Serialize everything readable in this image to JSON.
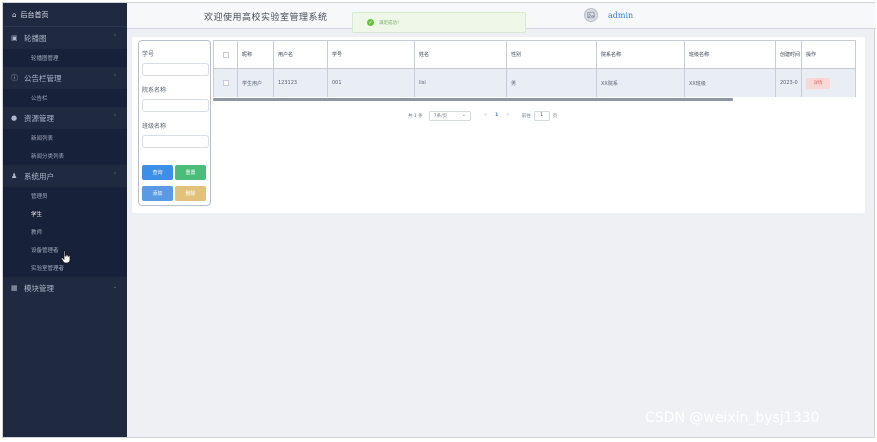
{
  "sidebar": {
    "home": "后台首页",
    "groups": [
      {
        "label": "轮播图",
        "icon": "image-icon",
        "items": [
          "轮播图管理"
        ]
      },
      {
        "label": "公告栏管理",
        "icon": "info-circle-icon",
        "items": [
          "公告栏"
        ]
      },
      {
        "label": "资源管理",
        "icon": "location-pin-icon",
        "items": [
          "新闻列表",
          "新闻分类列表"
        ]
      },
      {
        "label": "系统用户",
        "icon": "user-icon",
        "items": [
          "管理员",
          "学生",
          "教师",
          "设备管理者",
          "实验室管理者"
        ]
      },
      {
        "label": "模块管理",
        "icon": "grid-icon",
        "items": []
      }
    ],
    "active_item": "学生"
  },
  "header": {
    "title": "欢迎使用高校实验室管理系统",
    "toast": "满足成功！",
    "username": "admin"
  },
  "search": {
    "labels": [
      "学号",
      "院系名称",
      "班级名称"
    ],
    "buttons": {
      "search": "查询",
      "reset": "重置",
      "add": "添加",
      "delete": "删除"
    }
  },
  "table": {
    "columns": [
      "昵称",
      "用户名",
      "学号",
      "姓名",
      "性别",
      "院系名称",
      "班级名称",
      "创建时间",
      "操作"
    ],
    "rows": [
      {
        "nickname": "学生用户",
        "username": "123123",
        "student_id": "001",
        "name": "lisi",
        "gender": "男",
        "department": "XX院系",
        "class": "XX班级",
        "created": "2023-0",
        "action": "详情"
      }
    ]
  },
  "pagination": {
    "total": "共 1 条",
    "page_size": "7条/页",
    "prev": "<",
    "current": "1",
    "next": ">",
    "jump_label": "前往",
    "jump_value": "1",
    "jump_suffix": "页"
  },
  "watermark": "CSDN @weixin_bysj1330"
}
